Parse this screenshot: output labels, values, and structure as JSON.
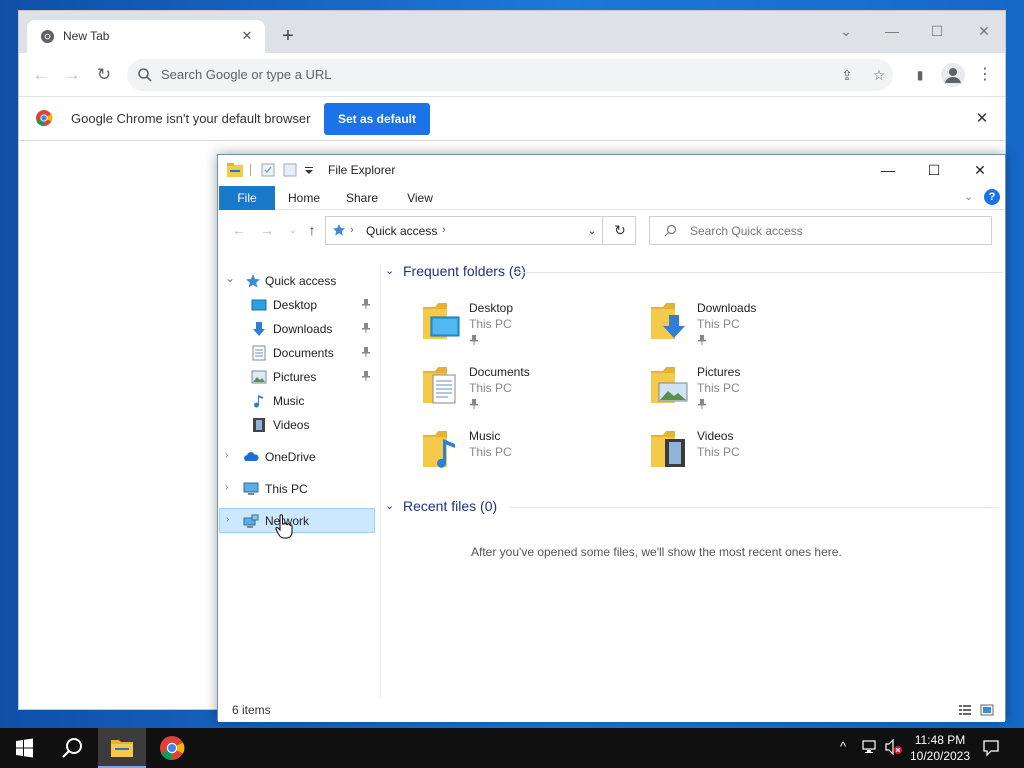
{
  "chrome": {
    "tab_title": "New Tab",
    "tab_close": "✕",
    "new_tab": "+",
    "window_controls": {
      "tab_search": "⌄",
      "minimize": "—",
      "maximize": "☐",
      "close": "✕"
    },
    "back": "←",
    "forward": "→",
    "reload": "↻",
    "omnibox_placeholder": "Search Google or type a URL",
    "share": "⇪",
    "bookmark": "☆",
    "side_panel": "▮",
    "menu": "⋮",
    "infobar": {
      "message": "Google Chrome isn't your default browser",
      "button": "Set as default",
      "close": "✕"
    }
  },
  "explorer": {
    "title": "File Explorer",
    "window_controls": {
      "minimize": "—",
      "maximize": "☐",
      "close": "✕"
    },
    "ribbon_tabs": [
      "File",
      "Home",
      "Share",
      "View"
    ],
    "ribbon_expand": "⌄",
    "help": "?",
    "nav_buttons": {
      "back": "←",
      "forward": "→",
      "recent": "⌄",
      "up": "↑"
    },
    "address": {
      "path": "Quick access",
      "sep": "›",
      "dropdown": "⌄",
      "refresh": "↻"
    },
    "search_placeholder": "Search Quick access",
    "nav_pane": {
      "quick_access": "Quick access",
      "pinned": [
        "Desktop",
        "Downloads",
        "Documents",
        "Pictures"
      ],
      "unpinned": [
        "Music",
        "Videos"
      ],
      "onedrive": "OneDrive",
      "this_pc": "This PC",
      "network": "Network",
      "expanded_chev": "⌄",
      "collapsed_chev": "›"
    },
    "frequent": {
      "header": "Frequent folders (6)",
      "folders": [
        {
          "name": "Desktop",
          "location": "This PC",
          "pinned": true
        },
        {
          "name": "Downloads",
          "location": "This PC",
          "pinned": true
        },
        {
          "name": "Documents",
          "location": "This PC",
          "pinned": true
        },
        {
          "name": "Pictures",
          "location": "This PC",
          "pinned": true
        },
        {
          "name": "Music",
          "location": "This PC",
          "pinned": false
        },
        {
          "name": "Videos",
          "location": "This PC",
          "pinned": false
        }
      ]
    },
    "recent": {
      "header": "Recent files (0)",
      "empty_message": "After you've opened some files, we'll show the most recent ones here."
    },
    "status": "6 items"
  },
  "taskbar": {
    "search": "⚲",
    "tray_chevron": "^",
    "clock_time": "11:48 PM",
    "clock_date": "10/20/2023",
    "notifications": "▭"
  },
  "colors": {
    "accent": "#1979ca",
    "chrome_blue": "#1a73e8",
    "selection": "#cce8ff",
    "group_title": "#1e3287",
    "folder": "#f5c94a",
    "taskbar": "#101010"
  }
}
